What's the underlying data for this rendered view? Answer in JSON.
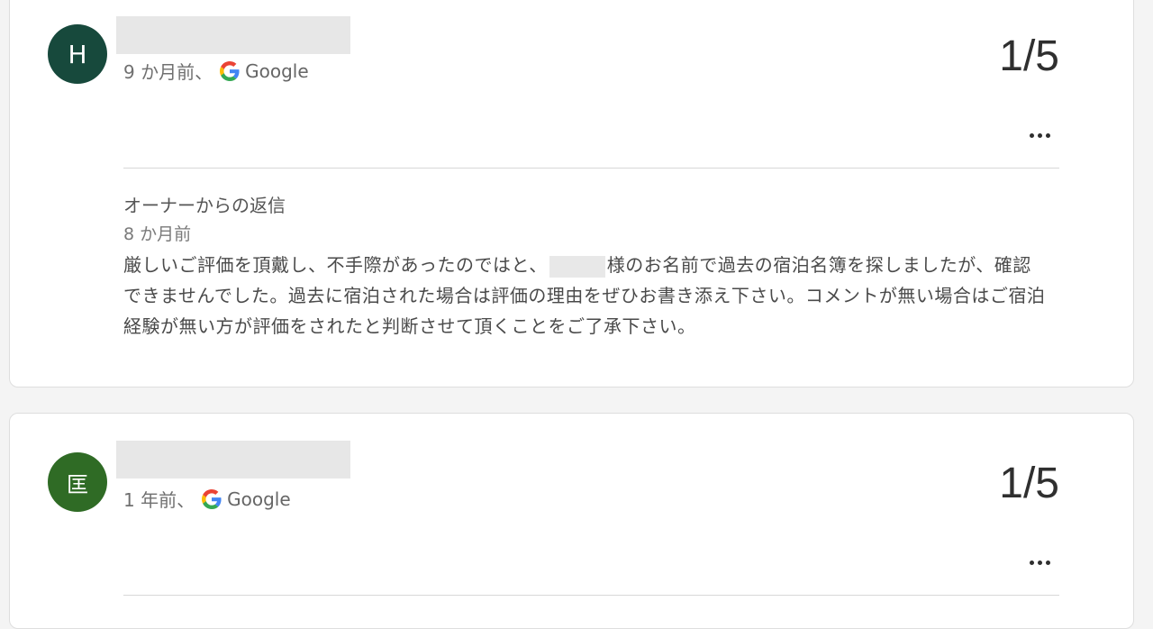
{
  "reviews": [
    {
      "avatar_letter": "H",
      "avatar_color": "#17493c",
      "reviewer_name": "",
      "time": "9 か月前、",
      "source": "Google",
      "rating": "1/5",
      "reply": {
        "title": "オーナーからの返信",
        "time": "8 か月前",
        "text_before": "厳しいご評価を頂戴し、不手際があったのではと、",
        "text_after": "様のお名前で過去の宿泊名簿を探しましたが、確認できませんでした。過去に宿泊された場合は評価の理由をぜひお書き添え下さい。コメントが無い場合はご宿泊経験が無い方が評価をされたと判断させて頂くことをご了承下さい。"
      }
    },
    {
      "avatar_letter": "匡",
      "avatar_color": "#2f6b25",
      "reviewer_name": "",
      "time": "1 年前、",
      "source": "Google",
      "rating": "1/5"
    }
  ],
  "icons": {
    "google": "google-g-icon",
    "more": "more-horiz-icon"
  },
  "colors": {
    "google_blue": "#4285F4",
    "google_red": "#EA4335",
    "google_yellow": "#FBBC05",
    "google_green": "#34A853"
  }
}
